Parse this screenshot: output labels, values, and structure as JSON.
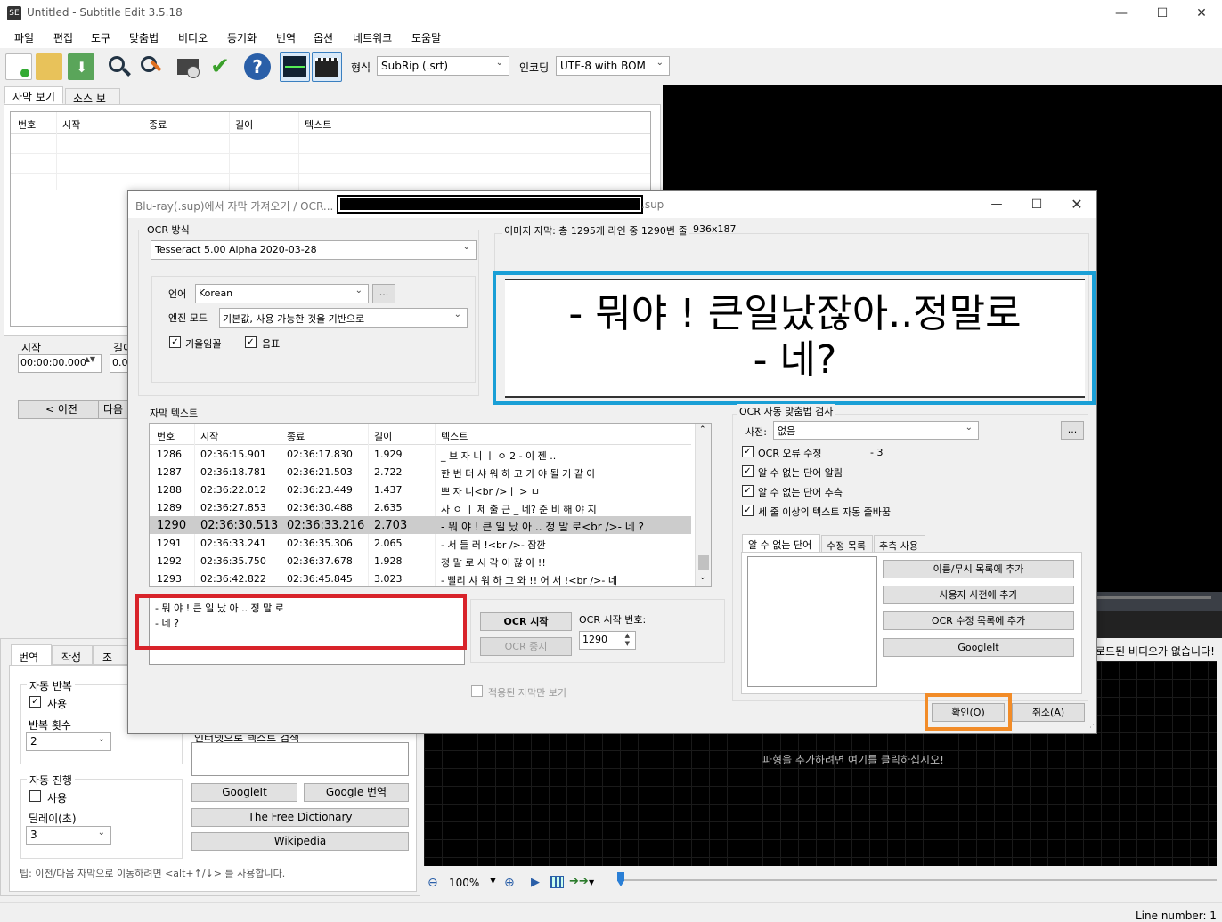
{
  "window": {
    "title": "Untitled - Subtitle Edit 3.5.18",
    "app_icon_text": "SE"
  },
  "menu": [
    "파일",
    "편집",
    "도구",
    "맞춤법",
    "비디오",
    "동기화",
    "번역",
    "옵션",
    "네트워크",
    "도움말"
  ],
  "toolbar": {
    "format_label": "형식",
    "format_value": "SubRip (.srt)",
    "encoding_label": "인코딩",
    "encoding_value": "UTF-8 with BOM"
  },
  "main_tabs": [
    "자막 보기",
    "소스 보기"
  ],
  "main_grid_headers": [
    "번호",
    "시작",
    "종료",
    "길이",
    "텍스트"
  ],
  "edit": {
    "start_label": "시작",
    "duration_label": "길이",
    "start_value": "00:00:00.000",
    "duration_value": "0.0",
    "prev_button": "< 이전",
    "next_button": "다음"
  },
  "bottom_tabs": [
    "번역",
    "작성",
    "조정"
  ],
  "auto_repeat": {
    "title": "자동 반복",
    "use_label": "사용",
    "count_label": "반복 횟수",
    "count_value": "2"
  },
  "auto_continue": {
    "title": "자동 진행",
    "use_label": "사용",
    "delay_label": "딜레이(초)",
    "delay_value": "3"
  },
  "search": {
    "label": "인터넷으로 텍스트 검색",
    "googleit": "GoogleIt",
    "google_translate": "Google 번역",
    "free_dictionary": "The Free Dictionary",
    "wikipedia": "Wikipedia"
  },
  "tip": "팁: 이전/다음 자막으로 이동하려면 <alt+↑/↓> 를 사용합니다.",
  "video": {
    "no_video": "로드된 비디오가 없습니다!",
    "waveform_hint": "파형을 추가하려면 여기를 클릭하십시오!",
    "zoom": "100%"
  },
  "status": {
    "line_number": "Line number: 1"
  },
  "dialog": {
    "title_prefix": "Blu-ray(.sup)에서 자막 가져오기 / OCR...",
    "title_suffix": ".sup",
    "ocr_method_label": "OCR 방식",
    "ocr_engine": "Tesseract 5.00 Alpha 2020-03-28",
    "language_label": "언어",
    "language_value": "Korean",
    "more_button": "...",
    "engine_mode_label": "엔진 모드",
    "engine_mode_value": "기본값, 사용 가능한 것을 기반으로",
    "italic_label": "기울임꼴",
    "music_label": "음표",
    "image_info": "이미지 자막: 총 1295개 라인 중 1290번 줄",
    "image_size": "936x187",
    "image_line1": "- 뭐야 ! 큰일났잖아..정말로",
    "image_line2": "- 네?",
    "subtitle_text_label": "자막 텍스트",
    "grid_headers": [
      "번호",
      "시작",
      "종료",
      "길이",
      "텍스트"
    ],
    "rows": [
      {
        "num": "1286",
        "start": "02:36:15.901",
        "end": "02:36:17.830",
        "dur": "1.929",
        "text": "_ 브 자 니 ㅣ ㅇ 2 - 이 젠 .."
      },
      {
        "num": "1287",
        "start": "02:36:18.781",
        "end": "02:36:21.503",
        "dur": "2.722",
        "text": "한 번 더 샤 워 하 고 가 야 될 거 같 아"
      },
      {
        "num": "1288",
        "start": "02:36:22.012",
        "end": "02:36:23.449",
        "dur": "1.437",
        "text": "쁘 자 니<br />ㅣ > ㅁ"
      },
      {
        "num": "1289",
        "start": "02:36:27.853",
        "end": "02:36:30.488",
        "dur": "2.635",
        "text": "사 ㅇ ㅣ 제 출 근 _ 네? 준 비 해 야 지"
      },
      {
        "num": "1290",
        "start": "02:36:30.513",
        "end": "02:36:33.216",
        "dur": "2.703",
        "text": "- 뭐 야 ! 큰 일 났 아 .. 정 말 로<br />- 네 ?"
      },
      {
        "num": "1291",
        "start": "02:36:33.241",
        "end": "02:36:35.306",
        "dur": "2.065",
        "text": "- 서 들 러 !<br />- 잠깐"
      },
      {
        "num": "1292",
        "start": "02:36:35.750",
        "end": "02:36:37.678",
        "dur": "1.928",
        "text": "정 말 로 시 각 이 잖 아 !!"
      },
      {
        "num": "1293",
        "start": "02:36:42.822",
        "end": "02:36:45.845",
        "dur": "3.023",
        "text": "- 빨리 샤 워 하 고 와 !! 어 서 !<br />- 네"
      }
    ],
    "edit_line1": "- 뭐 야 ! 큰 일 났 아 .. 정 말 로",
    "edit_line2": "- 네 ?",
    "ocr_start_button": "OCR 시작",
    "ocr_stop_button": "OCR 중지",
    "ocr_start_num_label": "OCR 시작 번호:",
    "ocr_start_num_value": "1290",
    "show_applied_label": "적용된 자막만 보기",
    "spell_group_label": "OCR 자동 맞춤법 검사",
    "dictionary_label": "사전:",
    "dictionary_value": "없음",
    "fix_ocr_label": "OCR 오류 수정",
    "fix_ocr_count": "- 3",
    "unknown_prompt_label": "알 수 없는 단어 알림",
    "unknown_guess_label": "알 수 없는 단어 추측",
    "auto_break_label": "세 줄 이상의 텍스트 자동 줄바꿈",
    "side_tabs": [
      "알 수 없는 단어",
      "수정 목록",
      "추측 사용"
    ],
    "add_names_button": "이름/무시 목록에 추가",
    "add_user_dict_button": "사용자 사전에 추가",
    "add_ocr_fix_button": "OCR 수정 목록에 추가",
    "googleit_button": "GoogleIt",
    "ok_button": "확인(O)",
    "cancel_button": "취소(A)"
  },
  "colors": {
    "highlight_blue": "#1a9fd6",
    "highlight_red": "#d8232a",
    "highlight_orange": "#f28c28",
    "selected_row": "#cccccc"
  }
}
